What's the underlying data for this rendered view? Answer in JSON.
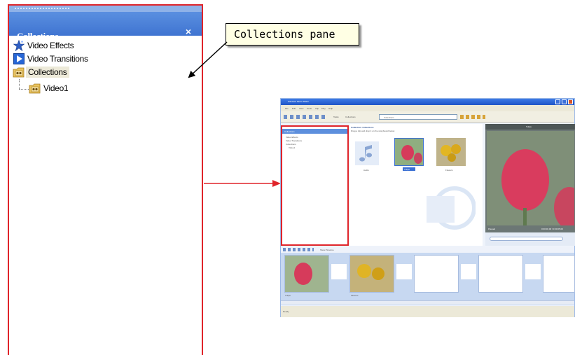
{
  "collections_pane": {
    "title": "Collections",
    "close_glyph": "×",
    "items": [
      {
        "label": "Video Effects",
        "icon": "star-icon"
      },
      {
        "label": "Video Transitions",
        "icon": "transition-icon"
      },
      {
        "label": "Collections",
        "icon": "collections-folder-icon",
        "selected": true
      },
      {
        "label": "Video1",
        "icon": "video-collection-icon"
      }
    ]
  },
  "callout": {
    "text": "Collections pane"
  },
  "mini_screenshot": {
    "window_title": "Windows Movie Maker",
    "menu": [
      "File",
      "Edit",
      "View",
      "Tools",
      "Clip",
      "Play",
      "Help"
    ],
    "toolbar_tasks": "Tasks",
    "toolbar_collections": "Collections",
    "toolbar_dropdown": "Collections",
    "pane_title": "Collections",
    "pane_items": [
      "Video Effects",
      "Video Transitions",
      "Collections",
      "Video1"
    ],
    "content_title": "Collection: Collections",
    "content_subtitle": "Drag a clip and drop it on the storyboard below.",
    "thumbs": [
      "Audio",
      "Tulips",
      "Flowers"
    ],
    "preview_title": "Tulips",
    "preview_status": "Paused",
    "preview_time": "0:00:00.00 / 0:00:05.00",
    "storyboard_label": "Show Timeline",
    "story_clips": [
      "Tulips",
      "Flowers"
    ],
    "status": "Ready"
  },
  "colors": {
    "highlight_border": "#e0242a",
    "pane_header": "#4a80d8",
    "callout_bg": "#ffffe4"
  }
}
